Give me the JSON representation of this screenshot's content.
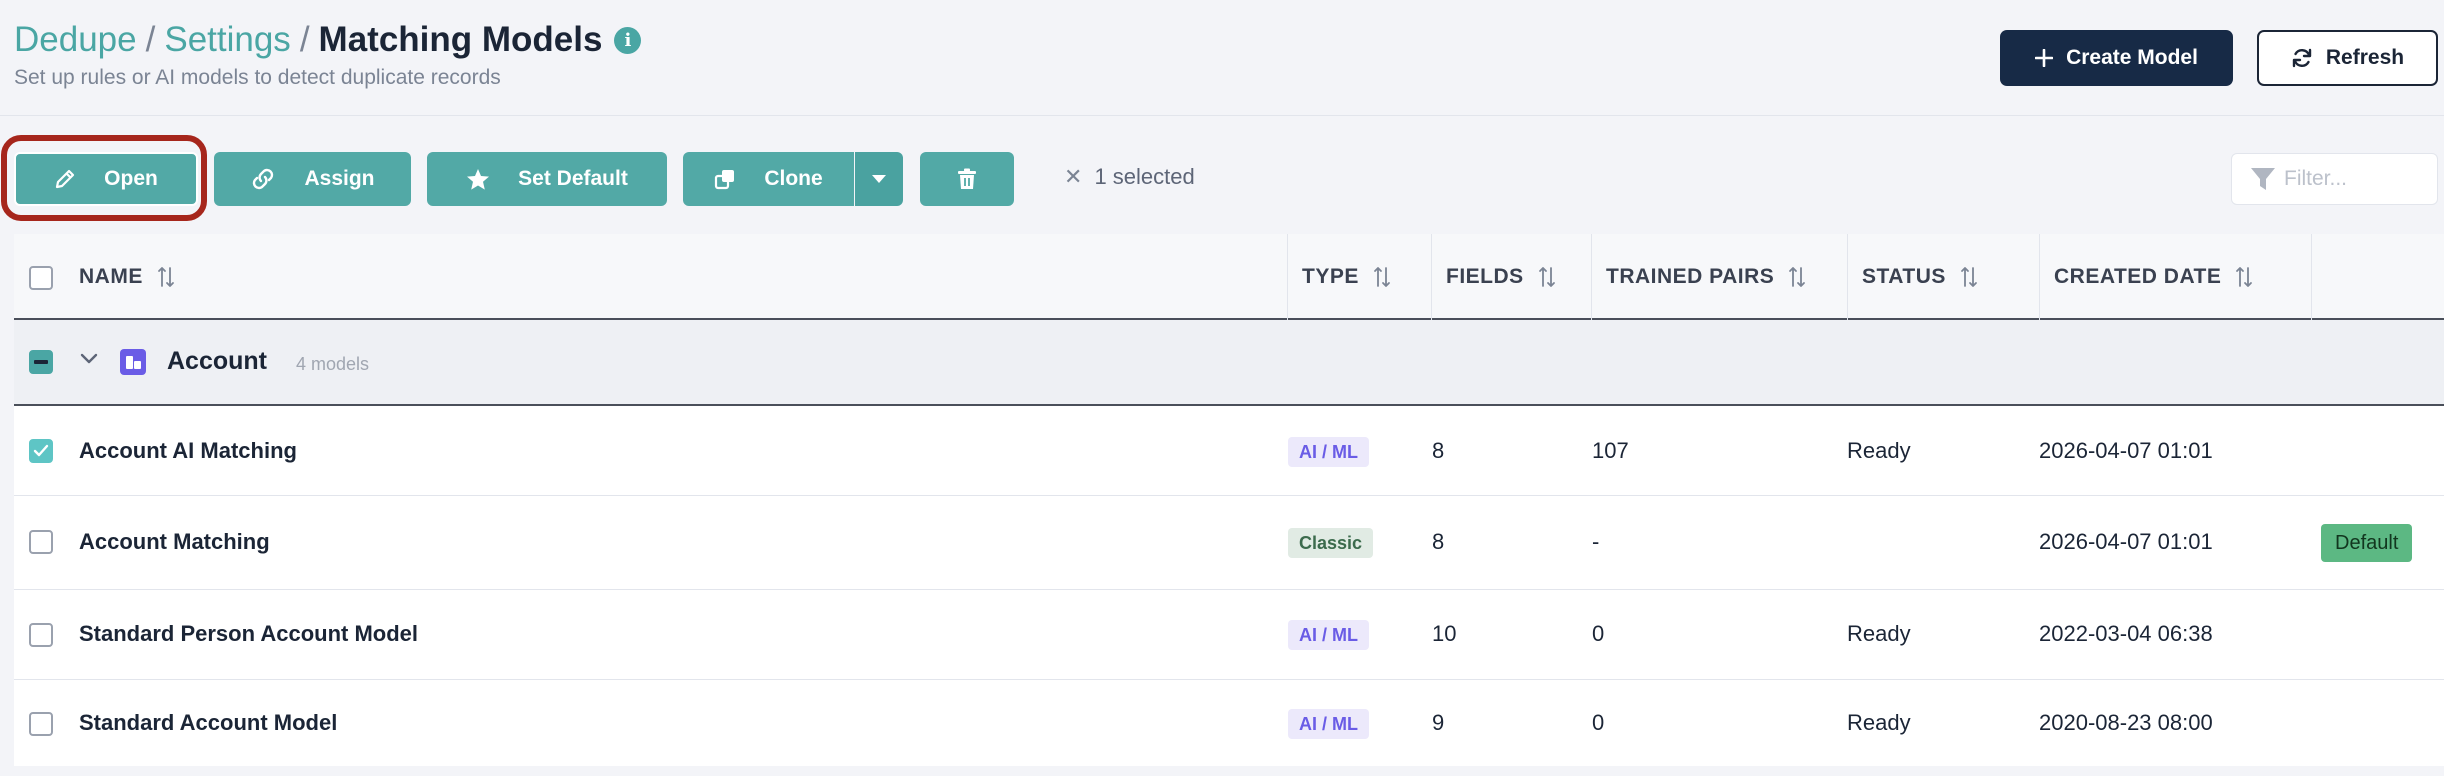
{
  "breadcrumb": {
    "items": [
      "Dedupe",
      "Settings"
    ],
    "current": "Matching Models",
    "separator": "/"
  },
  "subtitle": "Set up rules or AI models to detect duplicate records",
  "header_actions": {
    "create_label": "Create Model",
    "refresh_label": "Refresh"
  },
  "toolbar": {
    "open_label": "Open",
    "assign_label": "Assign",
    "set_default_label": "Set Default",
    "clone_label": "Clone",
    "selected_text": "1 selected",
    "filter_placeholder": "Filter..."
  },
  "table": {
    "columns": [
      "NAME",
      "TYPE",
      "FIELDS",
      "TRAINED PAIRS",
      "STATUS",
      "CREATED DATE"
    ],
    "group": {
      "name": "Account",
      "count_text": "4 models"
    },
    "rows": [
      {
        "name": "Account AI Matching",
        "type": "AI / ML",
        "fields": "8",
        "trained_pairs": "107",
        "status": "Ready",
        "created": "2026-04-07 01:01",
        "badge": "",
        "checked": true
      },
      {
        "name": "Account Matching",
        "type": "Classic",
        "fields": "8",
        "trained_pairs": "-",
        "status": "",
        "created": "2026-04-07 01:01",
        "badge": "Default",
        "checked": false
      },
      {
        "name": "Standard Person Account Model",
        "type": "AI / ML",
        "fields": "10",
        "trained_pairs": "0",
        "status": "Ready",
        "created": "2022-03-04 06:38",
        "badge": "",
        "checked": false
      },
      {
        "name": "Standard Account Model",
        "type": "AI / ML",
        "fields": "9",
        "trained_pairs": "0",
        "status": "Ready",
        "created": "2020-08-23 08:00",
        "badge": "",
        "checked": false
      }
    ]
  },
  "colors": {
    "accent": "#4aa6a4",
    "primary_button": "#172a46",
    "highlight": "#a6261c",
    "ai_badge": "#6a5ce6",
    "default_badge": "#5cb883"
  }
}
